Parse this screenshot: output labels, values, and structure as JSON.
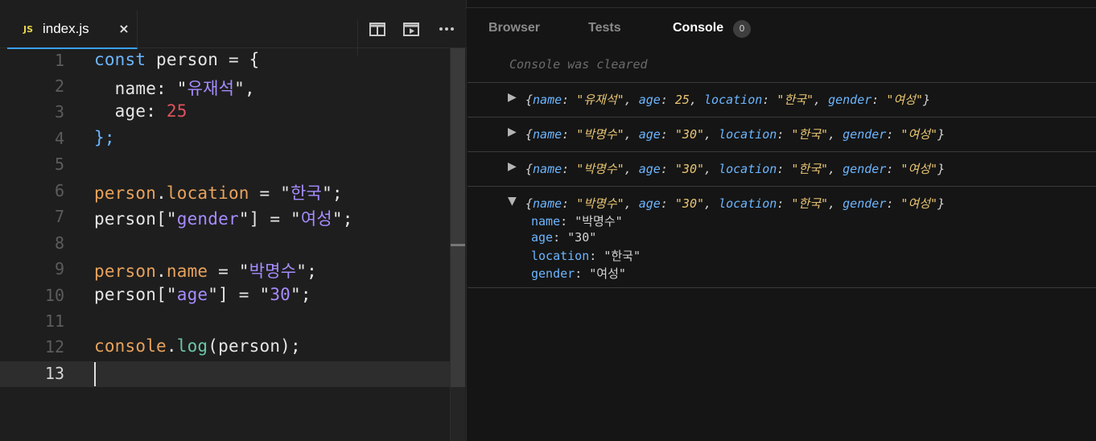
{
  "editor": {
    "file_badge": "JS",
    "file_name": "index.js",
    "close_glyph": "×",
    "toolbar": {
      "split_icon": "split-view-icon",
      "preview_icon": "preview-icon",
      "more_glyph": "···"
    },
    "line_numbers": [
      "1",
      "2",
      "3",
      "4",
      "5",
      "6",
      "7",
      "8",
      "9",
      "10",
      "11",
      "12",
      "13"
    ],
    "active_line": "13",
    "code": {
      "l1": {
        "kw": "const",
        "name": " person",
        "rest": " = {"
      },
      "l2": {
        "key": "  name: ",
        "q1": "\"",
        "str": "유재석",
        "q2": "\"",
        "end": ","
      },
      "l3": {
        "key": "  age: ",
        "num": "25"
      },
      "l4": {
        "text": "};"
      },
      "l6": {
        "obj": "person",
        "dot": ".",
        "prop": "location",
        "eq": " = ",
        "q1": "\"",
        "str": "한국",
        "q2": "\"",
        "end": ";"
      },
      "l7": {
        "obj": "person",
        "open": "[\"",
        "prop": "gender",
        "close": "\"]",
        "eq": " = ",
        "q1": "\"",
        "str": "여성",
        "q2": "\"",
        "end": ";"
      },
      "l9": {
        "obj": "person",
        "dot": ".",
        "prop": "name",
        "eq": " = ",
        "q1": "\"",
        "str": "박명수",
        "q2": "\"",
        "end": ";"
      },
      "l10": {
        "obj": "person",
        "open": "[\"",
        "prop": "age",
        "close": "\"]",
        "eq": " = ",
        "q1": "\"",
        "str": "30",
        "q2": "\"",
        "end": ";"
      },
      "l12": {
        "obj": "console",
        "dot": ".",
        "fn": "log",
        "args": "(person);"
      }
    }
  },
  "console": {
    "tabs": {
      "browser": "Browser",
      "tests": "Tests",
      "console": "Console"
    },
    "badge_count": "0",
    "cleared_message": "Console was cleared",
    "entries": [
      {
        "expanded": false,
        "name": "\"유재석\"",
        "age": "25",
        "location": "\"한국\"",
        "gender": "\"여성\""
      },
      {
        "expanded": false,
        "name": "\"박명수\"",
        "age": "\"30\"",
        "location": "\"한국\"",
        "gender": "\"여성\""
      },
      {
        "expanded": false,
        "name": "\"박명수\"",
        "age": "\"30\"",
        "location": "\"한국\"",
        "gender": "\"여성\""
      },
      {
        "expanded": true,
        "name": "\"박명수\"",
        "age": "\"30\"",
        "location": "\"한국\"",
        "gender": "\"여성\""
      }
    ],
    "keys": {
      "name": "name",
      "age": "age",
      "location": "location",
      "gender": "gender"
    },
    "expanded_props": [
      {
        "key": "name",
        "value": "\"박명수\""
      },
      {
        "key": "age",
        "value": "\"30\""
      },
      {
        "key": "location",
        "value": "\"한국\""
      },
      {
        "key": "gender",
        "value": "\"여성\""
      }
    ],
    "triangles": {
      "collapsed": "▶",
      "expanded": "▼"
    }
  }
}
